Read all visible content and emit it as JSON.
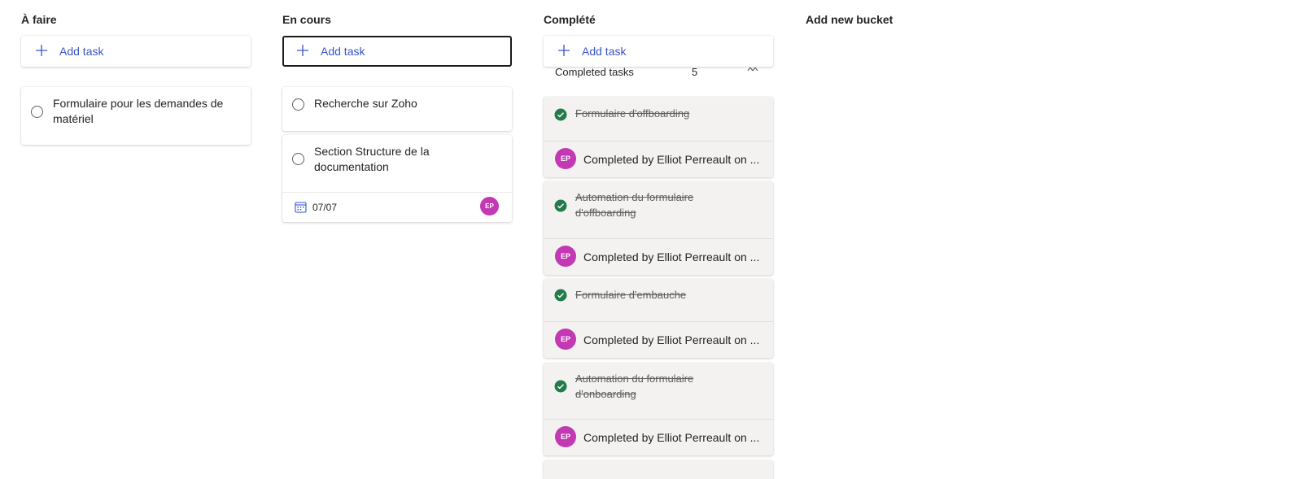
{
  "buckets": [
    {
      "title": "À faire",
      "add_task_label": "Add task",
      "tasks": [
        {
          "title": "Formulaire pour les demandes de matériel"
        }
      ]
    },
    {
      "title": "En cours",
      "add_task_label": "Add task",
      "tasks": [
        {
          "title": "Recherche sur Zoho"
        },
        {
          "title": "Section Structure de la documentation",
          "due_date": "07/07",
          "assignee_initials": "EP"
        }
      ]
    },
    {
      "title": "Complété",
      "add_task_label": "Add task",
      "completed_label": "Completed tasks",
      "completed_count": "5",
      "completed_tasks": [
        {
          "title": "Formulaire d'offboarding",
          "completed_by": "Completed by Elliot Perreault on ...",
          "initials": "EP"
        },
        {
          "title": "Automation du formulaire d'offboarding",
          "completed_by": "Completed by Elliot Perreault on ...",
          "initials": "EP"
        },
        {
          "title": "Formulaire d'embauche",
          "completed_by": "Completed by Elliot Perreault on ...",
          "initials": "EP"
        },
        {
          "title": "Automation du formulaire d'onboarding",
          "completed_by": "Completed by Elliot Perreault on ...",
          "initials": "EP"
        }
      ]
    }
  ],
  "add_bucket_label": "Add new bucket",
  "colors": {
    "accent": "#3a55c9",
    "avatar": "#c239b3",
    "check": "#237b4b",
    "completed_card_bg": "#f3f2f1"
  },
  "icons": {
    "add": "plus-icon",
    "date": "calendar-icon",
    "done": "check-circle-icon",
    "collapse": "chevron-up-icon"
  }
}
